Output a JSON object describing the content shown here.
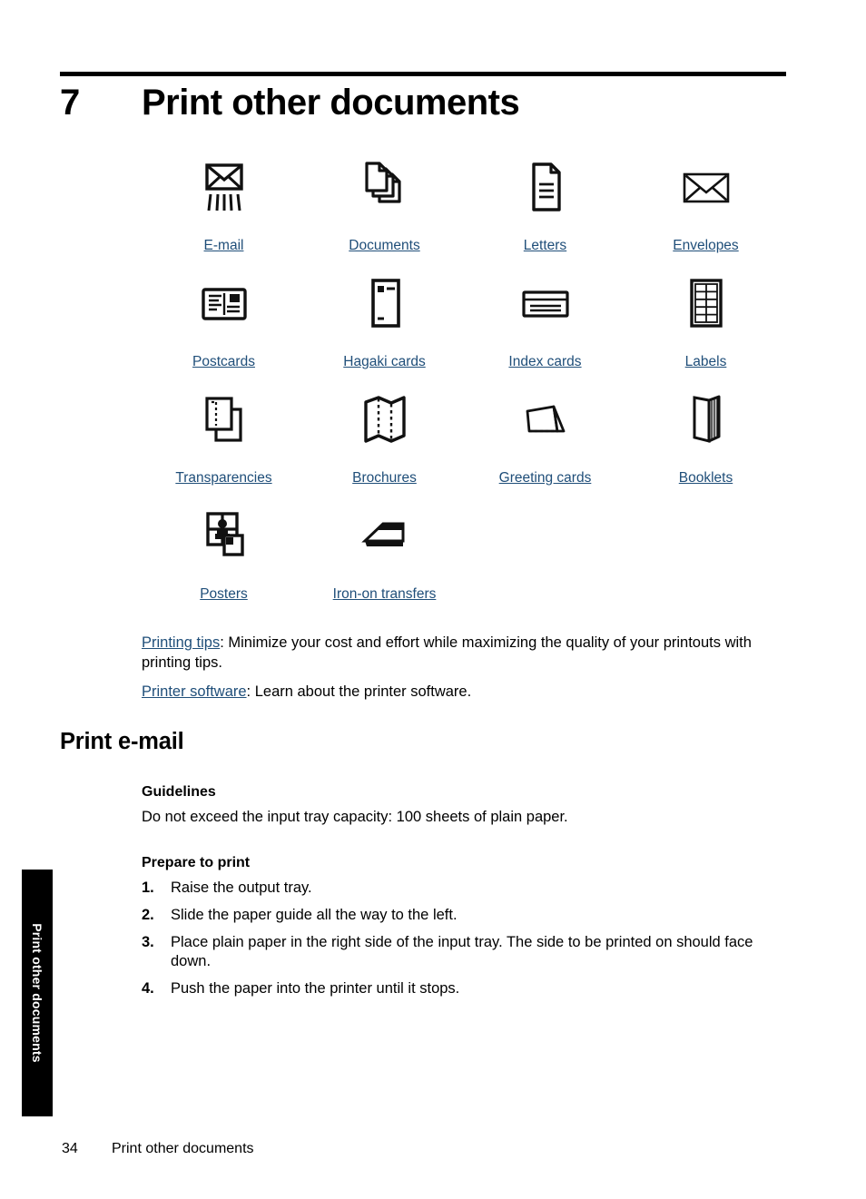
{
  "chapter": {
    "number": "7",
    "title": "Print other documents"
  },
  "icon_grid": {
    "rows": [
      [
        {
          "label": "E-mail",
          "icon": "email-envelope-speedlines-icon"
        },
        {
          "label": "Documents",
          "icon": "stacked-documents-icon"
        },
        {
          "label": "Letters",
          "icon": "letter-page-icon"
        },
        {
          "label": "Envelopes",
          "icon": "envelope-icon"
        }
      ],
      [
        {
          "label": "Postcards",
          "icon": "postcard-icon"
        },
        {
          "label": "Hagaki cards",
          "icon": "hagaki-card-icon"
        },
        {
          "label": "Index cards",
          "icon": "index-card-icon"
        },
        {
          "label": "Labels",
          "icon": "label-sheet-grid-icon"
        }
      ],
      [
        {
          "label": "Transparencies",
          "icon": "transparency-sheets-icon"
        },
        {
          "label": "Brochures",
          "icon": "folded-brochure-icon"
        },
        {
          "label": "Greeting cards",
          "icon": "tent-fold-card-icon"
        },
        {
          "label": "Booklets",
          "icon": "open-booklet-icon"
        }
      ],
      [
        {
          "label": "Posters",
          "icon": "poster-tiles-icon"
        },
        {
          "label": "Iron-on transfers",
          "icon": "clothes-iron-icon"
        }
      ]
    ]
  },
  "paragraphs": {
    "printing_tips": {
      "link": "Printing tips",
      "text": ": Minimize your cost and effort while maximizing the quality of your printouts with printing tips."
    },
    "printer_software": {
      "link": "Printer software",
      "text": ": Learn about the printer software."
    }
  },
  "section": {
    "heading": "Print e-mail",
    "guidelines_heading": "Guidelines",
    "guidelines_text": "Do not exceed the input tray capacity: 100 sheets of plain paper.",
    "prepare_heading": "Prepare to print",
    "steps": [
      {
        "num": "1.",
        "text": "Raise the output tray."
      },
      {
        "num": "2.",
        "text": "Slide the paper guide all the way to the left."
      },
      {
        "num": "3.",
        "text": "Place plain paper in the right side of the input tray. The side to be printed on should face down."
      },
      {
        "num": "4.",
        "text": "Push the paper into the printer until it stops."
      }
    ]
  },
  "side_tab": {
    "label": "Print other documents"
  },
  "footer": {
    "page_number": "34",
    "text": "Print other documents"
  },
  "colors": {
    "link": "#1f4e79",
    "rule": "#000000",
    "side_tab_background": "#000000"
  }
}
